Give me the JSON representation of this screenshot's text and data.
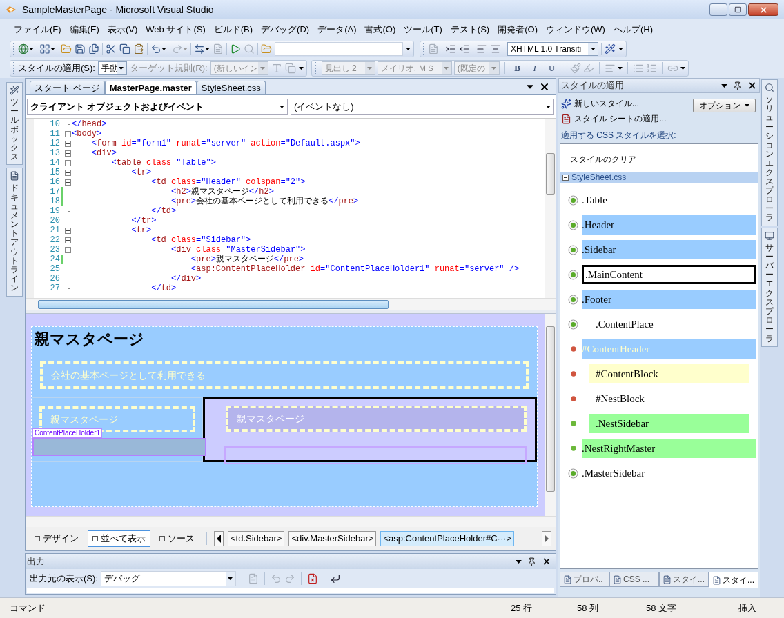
{
  "window": {
    "title": "SampleMasterPage - Microsoft Visual Studio"
  },
  "menu": [
    "ファイル(F)",
    "編集(E)",
    "表示(V)",
    "Web サイト(S)",
    "ビルド(B)",
    "デバッグ(D)",
    "データ(A)",
    "書式(O)",
    "ツール(T)",
    "テスト(S)",
    "開発者(O)",
    "ウィンドウ(W)",
    "ヘルプ(H)"
  ],
  "toolbar": {
    "doctype": {
      "value": "XHTML 1.0 Transiti",
      "disabled": false
    }
  },
  "style_toolbar": {
    "label": "スタイルの適用(S):",
    "mode": {
      "value": "手動",
      "disabled": false
    },
    "target_label": {
      "text": "ターゲット規則(R):",
      "disabled": true
    },
    "target": {
      "value": "(新しいイン",
      "disabled": true
    },
    "block_format": {
      "value": "見出し 2",
      "disabled": true
    },
    "font": {
      "value": "メイリオ, ＭＳ",
      "disabled": true
    },
    "size": {
      "value": "(既定の",
      "disabled": true
    },
    "format_buttons": [
      "B",
      "I",
      "U"
    ]
  },
  "left_dock": [
    "ツールボックス",
    "ドキュメントアウトライン"
  ],
  "document_tabs": [
    {
      "label": "スタート ページ",
      "selected": false
    },
    {
      "label": "MasterPage.master",
      "selected": true
    },
    {
      "label": "StyleSheet.css",
      "selected": false
    }
  ],
  "editor": {
    "object_dropdown": "クライアント オブジェクトおよびイベント",
    "event_dropdown": "(イベントなし)",
    "lines": [
      {
        "number": "10",
        "kind": "end",
        "changed": false,
        "tokens": [
          {
            "kind": "markup",
            "text": "</"
          },
          {
            "kind": "element",
            "text": "head"
          },
          {
            "kind": "markup",
            "text": ">"
          }
        ]
      },
      {
        "number": "11",
        "kind": "open",
        "changed": false,
        "tokens": [
          {
            "kind": "markup",
            "text": "<"
          },
          {
            "kind": "element",
            "text": "body"
          },
          {
            "kind": "markup",
            "text": ">"
          }
        ]
      },
      {
        "number": "12",
        "kind": "open",
        "changed": false,
        "tokens": [
          {
            "kind": "markup",
            "text": "    <"
          },
          {
            "kind": "element",
            "text": "form"
          },
          {
            "kind": "attribute",
            "text": " id"
          },
          {
            "kind": "markup",
            "text": "=\"form1\""
          },
          {
            "kind": "attribute",
            "text": " runat"
          },
          {
            "kind": "markup",
            "text": "=\"server\""
          },
          {
            "kind": "attribute",
            "text": " action"
          },
          {
            "kind": "markup",
            "text": "=\"Default.aspx\">"
          }
        ]
      },
      {
        "number": "13",
        "kind": "open",
        "changed": false,
        "tokens": [
          {
            "kind": "markup",
            "text": "    <"
          },
          {
            "kind": "element",
            "text": "div"
          },
          {
            "kind": "markup",
            "text": ">"
          }
        ]
      },
      {
        "number": "14",
        "kind": "open",
        "changed": false,
        "tokens": [
          {
            "kind": "markup",
            "text": "        <"
          },
          {
            "kind": "element",
            "text": "table"
          },
          {
            "kind": "attribute",
            "text": " class"
          },
          {
            "kind": "markup",
            "text": "=\"Table\">"
          }
        ]
      },
      {
        "number": "15",
        "kind": "open",
        "changed": false,
        "tokens": [
          {
            "kind": "markup",
            "text": "            <"
          },
          {
            "kind": "element",
            "text": "tr"
          },
          {
            "kind": "markup",
            "text": ">"
          }
        ]
      },
      {
        "number": "16",
        "kind": "open",
        "changed": false,
        "tokens": [
          {
            "kind": "markup",
            "text": "                <"
          },
          {
            "kind": "element",
            "text": "td"
          },
          {
            "kind": "attribute",
            "text": " class"
          },
          {
            "kind": "markup",
            "text": "=\"Header\""
          },
          {
            "kind": "attribute",
            "text": " colspan"
          },
          {
            "kind": "markup",
            "text": "=\"2\">"
          }
        ]
      },
      {
        "number": "17",
        "kind": "none",
        "changed": true,
        "tokens": [
          {
            "kind": "markup",
            "text": "                    <"
          },
          {
            "kind": "element",
            "text": "h2"
          },
          {
            "kind": "markup",
            "text": ">"
          },
          {
            "kind": "content",
            "text": "親マスタページ"
          },
          {
            "kind": "markup",
            "text": "</"
          },
          {
            "kind": "element",
            "text": "h2"
          },
          {
            "kind": "markup",
            "text": ">"
          }
        ]
      },
      {
        "number": "18",
        "kind": "none",
        "changed": true,
        "tokens": [
          {
            "kind": "markup",
            "text": "                    <"
          },
          {
            "kind": "element",
            "text": "pre"
          },
          {
            "kind": "markup",
            "text": ">"
          },
          {
            "kind": "content",
            "text": "会社の基本ページとして利用できる"
          },
          {
            "kind": "markup",
            "text": "</"
          },
          {
            "kind": "element",
            "text": "pre"
          },
          {
            "kind": "markup",
            "text": ">"
          }
        ]
      },
      {
        "number": "19",
        "kind": "end",
        "changed": false,
        "tokens": [
          {
            "kind": "markup",
            "text": "                </"
          },
          {
            "kind": "element",
            "text": "td"
          },
          {
            "kind": "markup",
            "text": ">"
          }
        ]
      },
      {
        "number": "20",
        "kind": "end",
        "changed": false,
        "tokens": [
          {
            "kind": "markup",
            "text": "            </"
          },
          {
            "kind": "element",
            "text": "tr"
          },
          {
            "kind": "markup",
            "text": ">"
          }
        ]
      },
      {
        "number": "21",
        "kind": "open",
        "changed": false,
        "tokens": [
          {
            "kind": "markup",
            "text": "            <"
          },
          {
            "kind": "element",
            "text": "tr"
          },
          {
            "kind": "markup",
            "text": ">"
          }
        ]
      },
      {
        "number": "22",
        "kind": "open",
        "changed": false,
        "tokens": [
          {
            "kind": "markup",
            "text": "                <"
          },
          {
            "kind": "element",
            "text": "td"
          },
          {
            "kind": "attribute",
            "text": " class"
          },
          {
            "kind": "markup",
            "text": "=\"Sidebar\">"
          }
        ]
      },
      {
        "number": "23",
        "kind": "open",
        "changed": false,
        "tokens": [
          {
            "kind": "markup",
            "text": "                    <"
          },
          {
            "kind": "element",
            "text": "div"
          },
          {
            "kind": "attribute",
            "text": " class"
          },
          {
            "kind": "markup",
            "text": "=\"MasterSidebar\">"
          }
        ]
      },
      {
        "number": "24",
        "kind": "none",
        "changed": true,
        "tokens": [
          {
            "kind": "markup",
            "text": "                        <"
          },
          {
            "kind": "element",
            "text": "pre"
          },
          {
            "kind": "markup",
            "text": ">"
          },
          {
            "kind": "content",
            "text": "親マスタページ"
          },
          {
            "kind": "markup",
            "text": "</"
          },
          {
            "kind": "element",
            "text": "pre"
          },
          {
            "kind": "markup",
            "text": ">"
          }
        ]
      },
      {
        "number": "25",
        "kind": "none",
        "changed": false,
        "tokens": [
          {
            "kind": "markup",
            "text": "                        <"
          },
          {
            "kind": "element",
            "text": "asp:ContentPlaceHolder"
          },
          {
            "kind": "attribute",
            "text": " id"
          },
          {
            "kind": "markup",
            "text": "=\"ContentPlaceHolder1\""
          },
          {
            "kind": "attribute",
            "text": " runat"
          },
          {
            "kind": "markup",
            "text": "=\"server\" />"
          }
        ]
      },
      {
        "number": "26",
        "kind": "end",
        "changed": false,
        "tokens": [
          {
            "kind": "markup",
            "text": "                    </"
          },
          {
            "kind": "element",
            "text": "div"
          },
          {
            "kind": "markup",
            "text": ">"
          }
        ]
      },
      {
        "number": "27",
        "kind": "end",
        "changed": false,
        "tokens": [
          {
            "kind": "markup",
            "text": "                </"
          },
          {
            "kind": "element",
            "text": "td"
          },
          {
            "kind": "markup",
            "text": ">"
          }
        ]
      }
    ]
  },
  "design": {
    "heading": "親マスタページ",
    "header_text": "会社の基本ページとして利用できる",
    "sidebar_text": "親マスタページ",
    "placeholder_label": "ContentPlaceHolder1",
    "main_text": "親マスタページ"
  },
  "view_tabs": [
    {
      "label": "デザイン",
      "selected": false
    },
    {
      "label": "並べて表示",
      "selected": true
    },
    {
      "label": "ソース",
      "selected": false
    }
  ],
  "breadcrumb": [
    {
      "label": "<td.Sidebar>",
      "selected": false
    },
    {
      "label": "<div.MasterSidebar>",
      "selected": false
    },
    {
      "label": "<asp:ContentPlaceHolder#C···>",
      "selected": true
    }
  ],
  "output": {
    "title": "出力",
    "source_label": "出力元の表示(S):",
    "source": "デバッグ"
  },
  "styles_panel": {
    "title": "スタイルの適用",
    "new_style": "新しいスタイル...",
    "attach_sheet": "スタイル シートの適用...",
    "options": "オプション",
    "prompt": "適用する CSS スタイルを選択:",
    "clear": "スタイルのクリア",
    "sheet": {
      "name": "StyleSheet.css",
      "expanded": true
    },
    "styles": [
      {
        "text": ".Table",
        "kind": "ring",
        "bordered": false,
        "padded": false,
        "light_text": false
      },
      {
        "text": ".Header",
        "kind": "ring",
        "color": "#99ccff",
        "bordered": false,
        "padded": false,
        "light_text": false
      },
      {
        "text": ".Sidebar",
        "kind": "ring",
        "color": "#99ccff",
        "bordered": false,
        "padded": false,
        "light_text": false
      },
      {
        "text": ".MainContent",
        "kind": "ring",
        "bordered": true,
        "padded": false,
        "light_text": false
      },
      {
        "text": ".Footer",
        "kind": "ring",
        "color": "#99ccff",
        "bordered": false,
        "padded": false,
        "light_text": false
      },
      {
        "text": ".ContentPlace",
        "kind": "ring",
        "bordered": false,
        "padded": true,
        "light_text": false
      },
      {
        "text": "#ContentHeader",
        "kind": "id",
        "color": "#99ccff",
        "bordered": false,
        "padded": false,
        "light_text": true
      },
      {
        "text": "#ContentBlock",
        "kind": "id",
        "color": "#ffffcc",
        "bordered": false,
        "padded": true,
        "light_text": false
      },
      {
        "text": "#NestBlock",
        "kind": "id",
        "bordered": false,
        "padded": true,
        "light_text": false
      },
      {
        "text": ".NestSidebar",
        "kind": "dot",
        "color": "#99ff99",
        "bordered": false,
        "padded": true,
        "light_text": false
      },
      {
        "text": ".NestRightMaster",
        "kind": "dot",
        "color": "#99ff99",
        "bordered": false,
        "padded": false,
        "light_text": false
      },
      {
        "text": ".MasterSidebar",
        "kind": "ring",
        "bordered": false,
        "padded": false,
        "light_text": false
      }
    ],
    "tabs": [
      {
        "label": "プロパ..",
        "selected": false
      },
      {
        "label": "CSS ...",
        "selected": false
      },
      {
        "label": "スタイ...",
        "selected": false
      },
      {
        "label": "スタイ...",
        "selected": true
      }
    ]
  },
  "right_dock": [
    "ソリューションエクスプローラ",
    "サーバーエクスプローラ"
  ],
  "status_bar": {
    "message": "コマンド",
    "line": "25 行",
    "column": "58 列",
    "char": "58 文字",
    "mode": "挿入"
  }
}
